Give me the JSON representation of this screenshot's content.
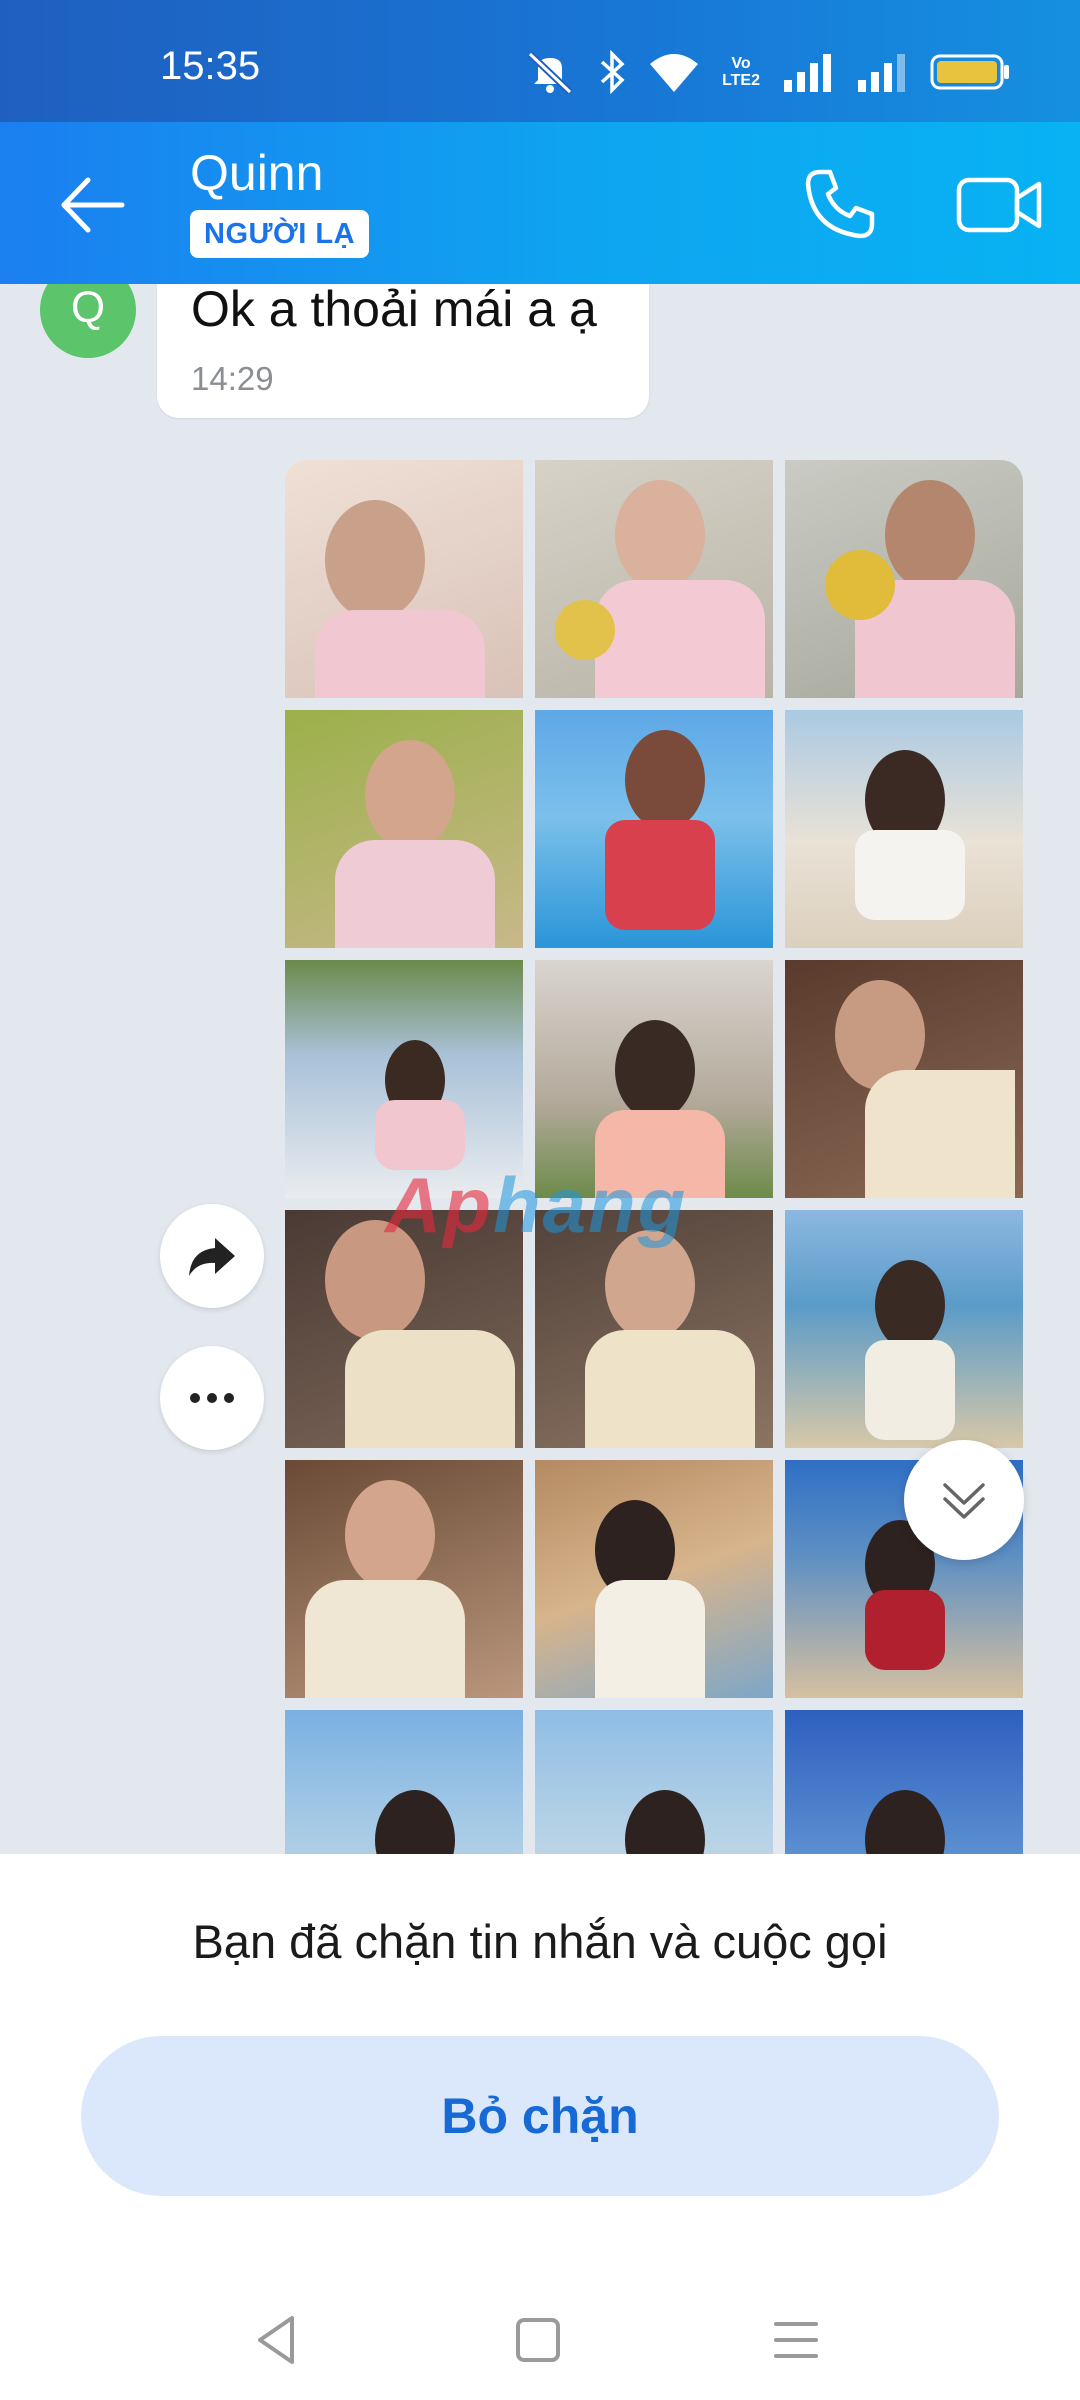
{
  "status_bar": {
    "time": "15:35",
    "volte_top": "Vo",
    "volte_bottom": "LTE2",
    "icons": [
      "mute-icon",
      "bluetooth-icon",
      "wifi-icon",
      "volte-icon",
      "signal-1-icon",
      "signal-2-icon",
      "battery-icon"
    ],
    "battery_color": "#e8c33d"
  },
  "header": {
    "contact_name": "Quinn",
    "badge": "NGƯỜI LẠ",
    "icons": [
      "back-arrow-icon",
      "phone-icon",
      "video-call-icon"
    ]
  },
  "chat": {
    "avatar_letter": "Q",
    "message_text": "Ok a thoải mái a ạ",
    "message_time": "14:29",
    "watermark_part1": "Ap",
    "watermark_part2": "hang",
    "icons": [
      "share-forward-icon",
      "more-options-icon",
      "scroll-down-icon"
    ]
  },
  "bottom": {
    "blocked_text": "Bạn đã chặn tin nhắn và cuộc gọi",
    "unblock_label": "Bỏ chặn"
  },
  "navbar": {
    "icons": [
      "nav-back-icon",
      "nav-home-icon",
      "nav-recents-icon"
    ]
  },
  "colors": {
    "accent": "#1769d6",
    "header_blue": "#1b7ff0",
    "avatar_green": "#5cc46b"
  }
}
